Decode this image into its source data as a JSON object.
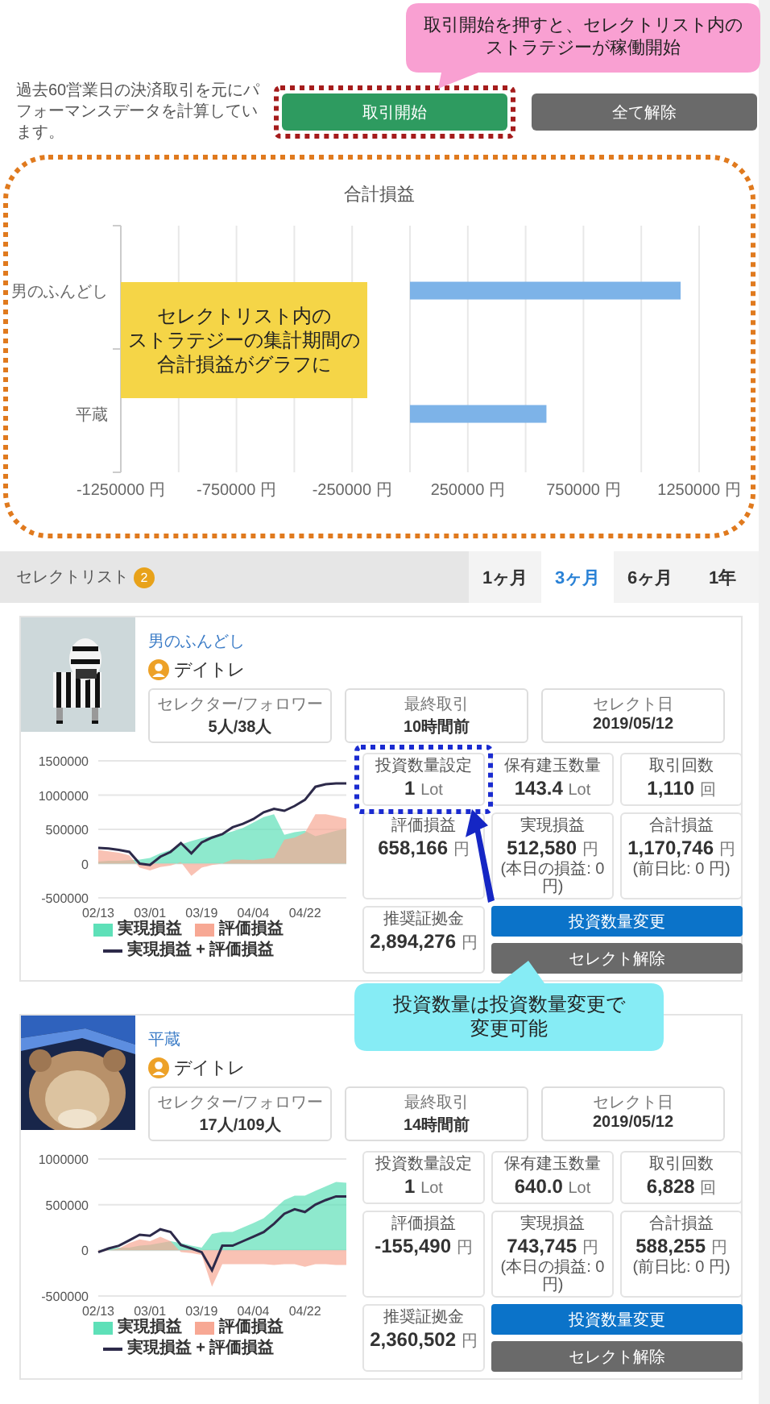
{
  "callouts": [
    {
      "kind": "pink",
      "color": "#f9a0d2",
      "lines": [
        "取引開始を押すと、セレクトリスト内の",
        "ストラテジーが稼働開始"
      ]
    },
    {
      "kind": "yellow",
      "color": "#f5d547",
      "lines": [
        "セレクトリスト内の",
        "ストラテジーの集計期間の",
        "合計損益がグラフに"
      ]
    },
    {
      "kind": "cyan",
      "color": "#86ecf5",
      "lines": [
        "投資数量は投資数量変更で",
        "変更可能"
      ]
    }
  ],
  "header": {
    "description": "過去60営業日の決済取引を元にパフォーマンスデータを計算しています。",
    "buttons": [
      {
        "label": "取引開始",
        "kind": "start",
        "highlighted": true
      },
      {
        "label": "全て解除",
        "kind": "clear",
        "highlighted": false
      }
    ]
  },
  "summary_chart": {
    "highlighted": true,
    "chart_data": {
      "type": "bar",
      "orientation": "horizontal",
      "grid": true,
      "title": "合計損益",
      "categories": [
        "男のふんどし",
        "平蔵"
      ],
      "values": [
        1170000,
        590000
      ],
      "xlim": [
        -1250000,
        1250000
      ],
      "xticks": [
        {
          "value": -1250000,
          "label": "-1250000 円"
        },
        {
          "value": -750000,
          "label": "-750000 円"
        },
        {
          "value": -250000,
          "label": "-250000 円"
        },
        {
          "value": 250000,
          "label": "250000 円"
        },
        {
          "value": 750000,
          "label": "750000 円"
        },
        {
          "value": 1250000,
          "label": "1250000 円"
        }
      ]
    }
  },
  "select_list": {
    "title": "セレクトリスト",
    "count": "2",
    "tabs": [
      {
        "label": "1ヶ月",
        "selected": false
      },
      {
        "label": "3ヶ月",
        "selected": true
      },
      {
        "label": "6ヶ月",
        "selected": false
      },
      {
        "label": "1年",
        "selected": false
      }
    ]
  },
  "strategies": [
    {
      "name": "男のふんどし",
      "style": "デイトレ",
      "info": [
        {
          "label": "セレクター/フォロワー",
          "value": "5人/38人"
        },
        {
          "label": "最終取引",
          "value": "10時間前"
        },
        {
          "label": "セレクト日",
          "value": "2019/05/12"
        }
      ],
      "stats": [
        {
          "label": "投資数量設定",
          "value": "1",
          "unit": "Lot",
          "highlighted": true
        },
        {
          "label": "保有建玉数量",
          "value": "143.4",
          "unit": "Lot",
          "highlighted": false
        },
        {
          "label": "取引回数",
          "value": "1,110",
          "unit": "回",
          "highlighted": false
        },
        {
          "label": "評価損益",
          "value": "658,166",
          "unit": "円",
          "highlighted": false
        },
        {
          "label": "実現損益",
          "value": "512,580",
          "unit": "円",
          "note": "(本日の損益: 0 円)",
          "highlighted": false
        },
        {
          "label": "合計損益",
          "value": "1,170,746",
          "unit": "円",
          "note": "(前日比: 0 円)",
          "highlighted": false
        },
        {
          "label": "推奨証拠金",
          "value": "2,894,276",
          "unit": "円",
          "highlighted": false
        }
      ],
      "buttons": [
        {
          "label": "投資数量変更",
          "kind": "primary"
        },
        {
          "label": "セレクト解除",
          "kind": "secondary"
        }
      ],
      "chart_data": {
        "type": "area",
        "categories": [
          "02/13",
          null,
          null,
          null,
          null,
          "03/01",
          null,
          null,
          null,
          null,
          "03/19",
          null,
          null,
          null,
          null,
          "04/04",
          null,
          null,
          null,
          null,
          "04/22",
          null,
          null,
          null,
          null
        ],
        "grid": true,
        "ylim": [
          -500000,
          1500000
        ],
        "yticks": [
          -500000,
          0,
          500000,
          1000000,
          1500000
        ],
        "series": [
          {
            "name": "実現損益",
            "color": "#5ee0b8",
            "type": "area",
            "values": [
              30000,
              40000,
              40000,
              50000,
              60000,
              80000,
              150000,
              200000,
              280000,
              330000,
              370000,
              400000,
              430000,
              470000,
              520000,
              600000,
              680000,
              720000,
              420000,
              460000,
              480000,
              400000,
              440000,
              480000,
              510000
            ]
          },
          {
            "name": "評価損益",
            "color": "#f7a894",
            "type": "area",
            "values": [
              200000,
              180000,
              160000,
              120000,
              -60000,
              -100000,
              -50000,
              -30000,
              20000,
              -180000,
              -60000,
              -20000,
              0,
              60000,
              60000,
              50000,
              70000,
              80000,
              350000,
              380000,
              450000,
              720000,
              720000,
              690000,
              660000
            ]
          },
          {
            "name": "実現損益 + 評価損益",
            "color": "#2d2a4a",
            "type": "line",
            "values": [
              230000,
              220000,
              200000,
              170000,
              0,
              -20000,
              100000,
              170000,
              300000,
              150000,
              310000,
              380000,
              430000,
              530000,
              580000,
              650000,
              750000,
              800000,
              770000,
              840000,
              930000,
              1120000,
              1160000,
              1170000,
              1170000
            ]
          }
        ]
      }
    },
    {
      "name": "平蔵",
      "style": "デイトレ",
      "info": [
        {
          "label": "セレクター/フォロワー",
          "value": "17人/109人"
        },
        {
          "label": "最終取引",
          "value": "14時間前"
        },
        {
          "label": "セレクト日",
          "value": "2019/05/12"
        }
      ],
      "stats": [
        {
          "label": "投資数量設定",
          "value": "1",
          "unit": "Lot",
          "highlighted": false
        },
        {
          "label": "保有建玉数量",
          "value": "640.0",
          "unit": "Lot",
          "highlighted": false
        },
        {
          "label": "取引回数",
          "value": "6,828",
          "unit": "回",
          "highlighted": false
        },
        {
          "label": "評価損益",
          "value": "-155,490",
          "unit": "円",
          "highlighted": false
        },
        {
          "label": "実現損益",
          "value": "743,745",
          "unit": "円",
          "note": "(本日の損益: 0 円)",
          "highlighted": false
        },
        {
          "label": "合計損益",
          "value": "588,255",
          "unit": "円",
          "note": "(前日比: 0 円)",
          "highlighted": false
        },
        {
          "label": "推奨証拠金",
          "value": "2,360,502",
          "unit": "円",
          "highlighted": false
        }
      ],
      "buttons": [
        {
          "label": "投資数量変更",
          "kind": "primary"
        },
        {
          "label": "セレクト解除",
          "kind": "secondary"
        }
      ],
      "chart_data": {
        "type": "area",
        "categories": [
          "02/13",
          null,
          null,
          null,
          null,
          "03/01",
          null,
          null,
          null,
          null,
          "03/19",
          null,
          null,
          null,
          null,
          "04/04",
          null,
          null,
          null,
          null,
          "04/22",
          null,
          null,
          null,
          null
        ],
        "grid": true,
        "ylim": [
          -500000,
          1000000
        ],
        "yticks": [
          -500000,
          0,
          500000,
          1000000
        ],
        "series": [
          {
            "name": "実現損益",
            "color": "#5ee0b8",
            "type": "area",
            "values": [
              0,
              20000,
              30000,
              30000,
              50000,
              60000,
              80000,
              100000,
              80000,
              50000,
              30000,
              180000,
              200000,
              200000,
              250000,
              300000,
              350000,
              450000,
              550000,
              600000,
              600000,
              650000,
              700000,
              750000,
              740000
            ]
          },
          {
            "name": "評価損益",
            "color": "#f7a894",
            "type": "area",
            "values": [
              -20000,
              0,
              20000,
              80000,
              120000,
              100000,
              150000,
              100000,
              -20000,
              -30000,
              -50000,
              -400000,
              -150000,
              -150000,
              -150000,
              -150000,
              -150000,
              -160000,
              -150000,
              -150000,
              -180000,
              -150000,
              -150000,
              -160000,
              -160000
            ]
          },
          {
            "name": "実現損益 + 評価損益",
            "color": "#2d2a4a",
            "type": "line",
            "values": [
              -20000,
              20000,
              50000,
              110000,
              170000,
              160000,
              230000,
              200000,
              60000,
              20000,
              -20000,
              -220000,
              50000,
              50000,
              100000,
              150000,
              200000,
              290000,
              400000,
              450000,
              420000,
              500000,
              550000,
              590000,
              590000
            ]
          }
        ]
      }
    }
  ]
}
